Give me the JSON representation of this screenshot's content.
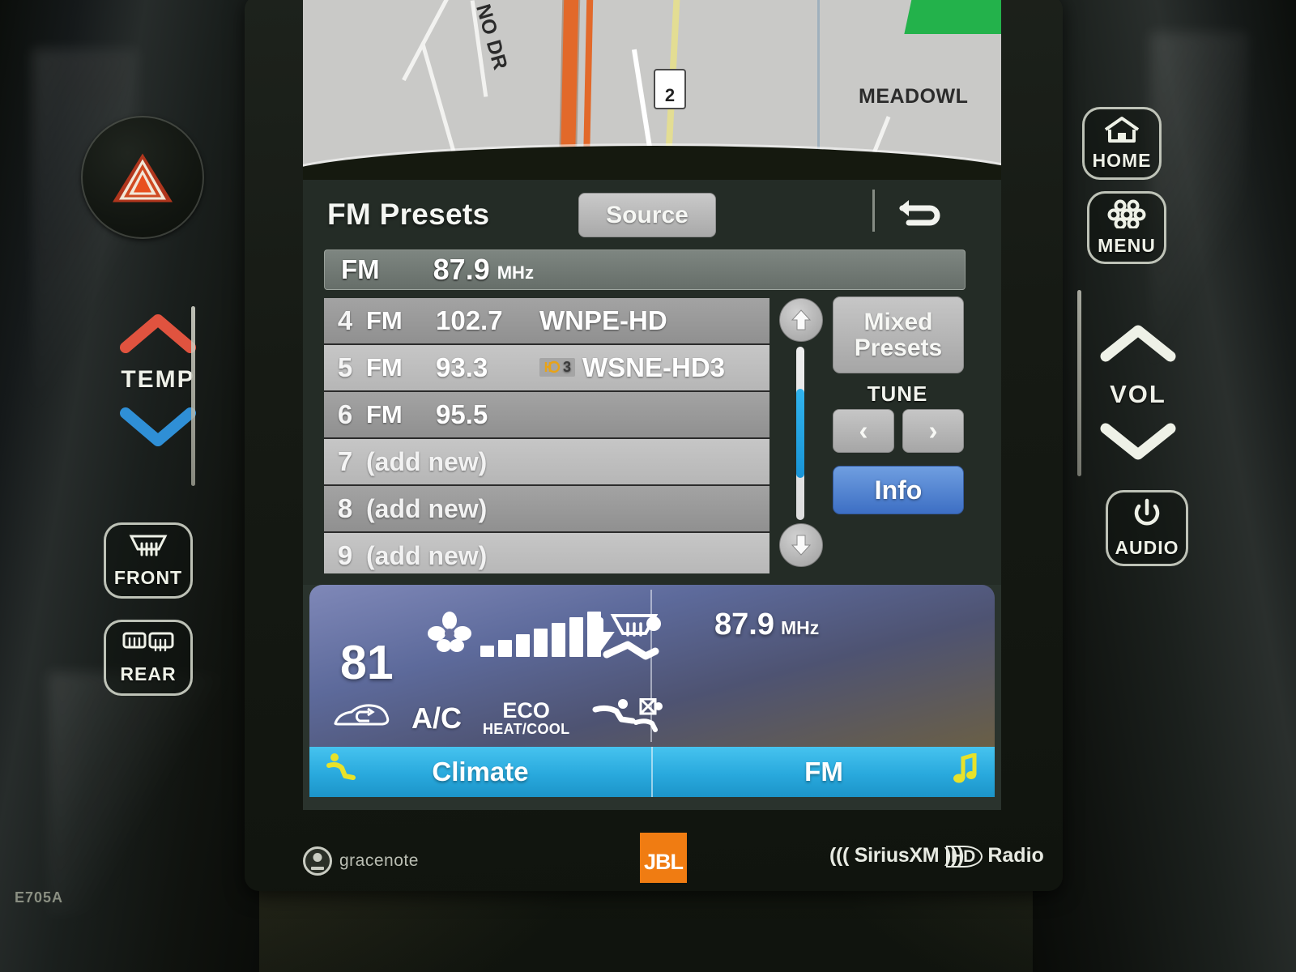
{
  "hardware": {
    "left": {
      "hazard_icon": "hazard-triangle-icon",
      "temp_label": "TEMP",
      "temp_up_icon": "chevron-up-icon",
      "temp_down_icon": "chevron-down-icon",
      "defrost_front_label": "FRONT",
      "defrost_front_icon": "windshield-defrost-icon",
      "defrost_rear_label": "REAR",
      "defrost_rear_icon": "rear-defrost-icon"
    },
    "right": {
      "home_label": "HOME",
      "home_icon": "house-icon",
      "menu_label": "MENU",
      "menu_icon": "apps-dots-icon",
      "vol_label": "VOL",
      "vol_up_icon": "chevron-up-icon",
      "vol_down_icon": "chevron-down-icon",
      "audio_label": "AUDIO",
      "audio_icon": "power-icon"
    }
  },
  "map": {
    "street_label": "NO DR",
    "area_label": "MEADOWL",
    "route_shield": "2"
  },
  "radio": {
    "title": "FM Presets",
    "source_label": "Source",
    "back_icon": "back-arrow-icon",
    "now_playing": {
      "band": "FM",
      "frequency": "87.9",
      "unit": "MHz"
    },
    "presets": [
      {
        "number": "4",
        "band": "FM",
        "frequency": "102.7",
        "station": "WNPE-HD",
        "hd": "",
        "empty": false
      },
      {
        "number": "5",
        "band": "FM",
        "frequency": "93.3",
        "station": "WSNE-HD3",
        "hd": "3",
        "empty": false
      },
      {
        "number": "6",
        "band": "FM",
        "frequency": "95.5",
        "station": "",
        "hd": "",
        "empty": false
      },
      {
        "number": "7",
        "band": "",
        "frequency": "",
        "station": "(add new)",
        "hd": "",
        "empty": true
      },
      {
        "number": "8",
        "band": "",
        "frequency": "",
        "station": "(add new)",
        "hd": "",
        "empty": true
      },
      {
        "number": "9",
        "band": "",
        "frequency": "",
        "station": "(add new)",
        "hd": "",
        "empty": true
      }
    ],
    "controls": {
      "scroll_up_icon": "scroll-up-arrow-icon",
      "scroll_down_icon": "scroll-down-arrow-icon",
      "mixed_presets_line1": "Mixed",
      "mixed_presets_line2": "Presets",
      "tune_label": "TUNE",
      "tune_prev": "‹",
      "tune_next": "›",
      "info_label": "Info"
    }
  },
  "bottom": {
    "climate": {
      "temperature": "81",
      "fan_icon": "fan-icon",
      "fan_bars": 7,
      "airflow_icon": "defrost-and-face-airflow-icon",
      "recirculate_icon": "air-recirculation-icon",
      "ac_label": "A/C",
      "eco_line1": "ECO",
      "eco_line2": "HEAT/COOL",
      "seat_airflow_icon": "front-seat-airflow-icon",
      "rear_seat_off_icon": "rear-seat-airflow-off-icon"
    },
    "audio": {
      "frequency": "87.9",
      "unit": "MHz"
    },
    "tabs": [
      {
        "label": "Climate",
        "icon": "seat-climate-icon"
      },
      {
        "label": "FM",
        "icon": "music-note-icon"
      }
    ]
  },
  "branding": {
    "gracenote": "gracenote",
    "jbl": "JBL",
    "siriusxm": "((( SiriusXM )))",
    "hd_prefix": "HD",
    "hd_radio": "Radio",
    "model_code": "E705A"
  },
  "colors": {
    "accent_blue": "#29a9dd",
    "info_blue": "#3d6fc4",
    "scroll_thumb": "#1894d6",
    "hd_badge": "#e8a317",
    "jbl_orange": "#f07c12",
    "tab_icon_yellow": "#e8e22a"
  }
}
